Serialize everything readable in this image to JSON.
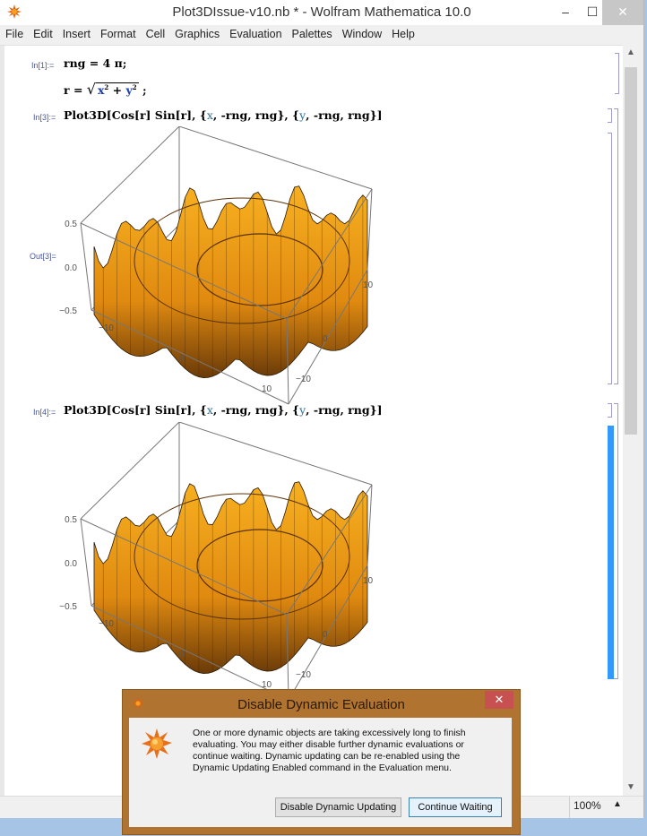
{
  "window": {
    "title": "Plot3DIssue-v10.nb * - Wolfram Mathematica 10.0",
    "controls": {
      "minimize": "‒",
      "maximize": "☐",
      "close": "✕"
    }
  },
  "menu": [
    "File",
    "Edit",
    "Insert",
    "Format",
    "Cell",
    "Graphics",
    "Evaluation",
    "Palettes",
    "Window",
    "Help"
  ],
  "cells": {
    "in1": {
      "label": "In[1]:=",
      "line1": "rng = 4 π;",
      "line2_prefix": "r = ",
      "line2_x": "x",
      "line2_y": "y",
      "line2_suffix": " ;"
    },
    "in3": {
      "label": "In[3]:=",
      "code_a": "Plot3D[Cos[r] Sin[r], {",
      "var_x": "x",
      "code_b": ", -rng, rng}, {",
      "var_y": "y",
      "code_c": ", -rng, rng}]"
    },
    "out3": {
      "label": "Out[3]="
    },
    "in4": {
      "label": "In[4]:=",
      "code_a": "Plot3D[Cos[r] Sin[r], {",
      "var_x": "x",
      "code_b": ", -rng, rng}, {",
      "var_y": "y",
      "code_c": ", -rng, rng}]"
    }
  },
  "plot": {
    "z_ticks": [
      "0.5",
      "0.0",
      "−0.5"
    ],
    "x_ticks": [
      "−10",
      "0",
      "10"
    ],
    "y_ticks": [
      "−10",
      "0",
      "10"
    ],
    "surface_color": "#e08a10"
  },
  "status": {
    "zoom": "100%",
    "zoom_arrow": "▲"
  },
  "dialog": {
    "title": "Disable Dynamic Evaluation",
    "close": "✕",
    "message": "One or more dynamic objects are taking excessively long to finish evaluating.  You may either disable further dynamic evaluations or continue waiting.  Dynamic updating can be re-enabled using the Dynamic Updating Enabled command in the Evaluation menu.",
    "disable_button": "Disable Dynamic Updating",
    "continue_button": "Continue Waiting"
  }
}
